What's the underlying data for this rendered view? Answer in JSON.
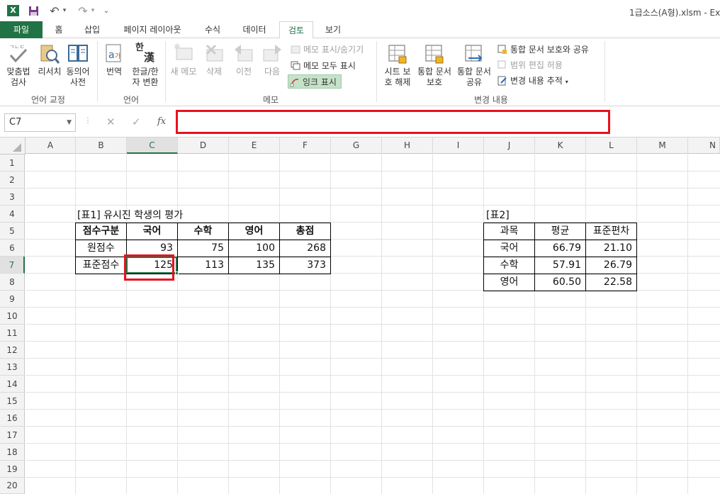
{
  "window": {
    "app_icon": "X",
    "title": "1급소스(A형).xlsm - Exc"
  },
  "qat": {
    "save": "save-icon",
    "undo": "↶",
    "redo": "↷",
    "customize": "⌄"
  },
  "tabs": [
    {
      "label": "파일"
    },
    {
      "label": "홈"
    },
    {
      "label": "삽입"
    },
    {
      "label": "페이지 레이아웃"
    },
    {
      "label": "수식"
    },
    {
      "label": "데이터"
    },
    {
      "label": "검토"
    },
    {
      "label": "보기"
    }
  ],
  "ribbon": {
    "proofing": {
      "group": "언어 교정",
      "spelling": [
        "맞춤법",
        "검사"
      ],
      "research": "리서치",
      "thesaurus": [
        "동의어",
        "사전"
      ]
    },
    "language": {
      "group": "언어",
      "translate": "번역",
      "hangul_hanja": [
        "한글/한",
        "자 변환"
      ],
      "hangul_icon": "한",
      "hanja_icon": "漢"
    },
    "comments": {
      "group": "메모",
      "new": "새 메모",
      "delete": "삭제",
      "previous": "이전",
      "next": "다음",
      "show_hide": "메모 표시/숨기기",
      "show_all": "메모 모두 표시",
      "show_ink": "잉크 표시"
    },
    "changes": {
      "group": "변경 내용",
      "unprotect_sheet": [
        "시트 보",
        "호 해제"
      ],
      "protect_shared": [
        "통합 문서",
        "보호"
      ],
      "share_workbook": [
        "통합 문서",
        "공유"
      ],
      "protect_and_share": "통합 문서 보호와 공유",
      "allow_edit_ranges": "범위 편집 허용",
      "track_changes": "변경 내용 추적"
    }
  },
  "formula_bar": {
    "name_box": "C7",
    "cancel": "✕",
    "enter": "✓",
    "fx": "fx",
    "value": ""
  },
  "grid": {
    "columns": [
      "A",
      "B",
      "C",
      "D",
      "E",
      "F",
      "G",
      "H",
      "I",
      "J",
      "K",
      "L",
      "M",
      "N"
    ],
    "rows": [
      "1",
      "2",
      "3",
      "4",
      "5",
      "6",
      "7",
      "8",
      "9",
      "10",
      "11",
      "12",
      "13",
      "14",
      "15",
      "16",
      "17",
      "18",
      "19",
      "20"
    ],
    "selected_col": "C",
    "selected_row": "7"
  },
  "table1": {
    "title": "[표1] 유시진 학생의 평가",
    "headers": [
      "점수구분",
      "국어",
      "수학",
      "영어",
      "총점"
    ],
    "rows": [
      [
        "원점수",
        "93",
        "75",
        "100",
        "268"
      ],
      [
        "표준점수",
        "125",
        "113",
        "135",
        "373"
      ]
    ]
  },
  "table2": {
    "title": "[표2]",
    "headers": [
      "과목",
      "평균",
      "표준편차"
    ],
    "rows": [
      [
        "국어",
        "66.79",
        "21.10"
      ],
      [
        "수학",
        "57.91",
        "26.79"
      ],
      [
        "영어",
        "60.50",
        "22.58"
      ]
    ]
  },
  "colors": {
    "excel_green": "#217346",
    "highlight_red": "#e8121e"
  }
}
